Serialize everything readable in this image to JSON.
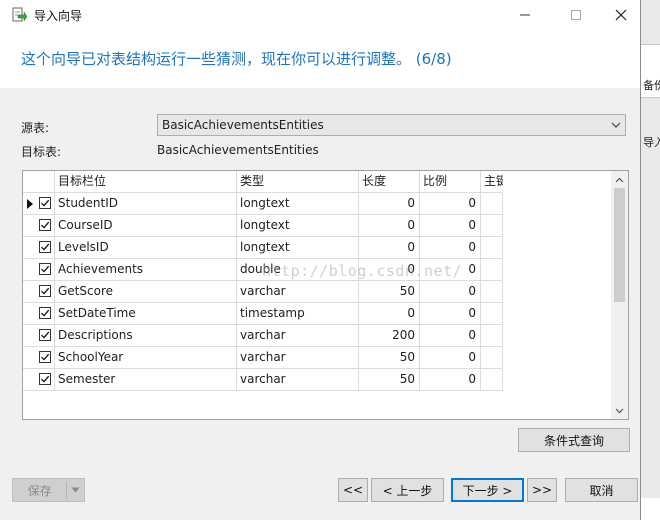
{
  "window": {
    "title": "导入向导",
    "controls": {
      "minimize": "—",
      "maximize": "☐",
      "close": "✕"
    }
  },
  "heading": "这个向导已对表结构运行一些猜测，现在你可以进行调整。 (6/8)",
  "source": {
    "label": "源表:",
    "value": "BasicAchievementsEntities"
  },
  "target": {
    "label": "目标表:",
    "value": "BasicAchievementsEntities"
  },
  "grid": {
    "columns": [
      "目标栏位",
      "类型",
      "长度",
      "比例",
      "主键"
    ],
    "rows": [
      {
        "name": "StudentID",
        "type": "longtext",
        "length": "0",
        "scale": "0",
        "checked": true,
        "current": true
      },
      {
        "name": "CourseID",
        "type": "longtext",
        "length": "0",
        "scale": "0",
        "checked": true,
        "current": false
      },
      {
        "name": "LevelsID",
        "type": "longtext",
        "length": "0",
        "scale": "0",
        "checked": true,
        "current": false
      },
      {
        "name": "Achievements",
        "type": "double",
        "length": "0",
        "scale": "0",
        "checked": true,
        "current": false
      },
      {
        "name": "GetScore",
        "type": "varchar",
        "length": "50",
        "scale": "0",
        "checked": true,
        "current": false
      },
      {
        "name": "SetDateTime",
        "type": "timestamp",
        "length": "0",
        "scale": "0",
        "checked": true,
        "current": false
      },
      {
        "name": "Descriptions",
        "type": "varchar",
        "length": "200",
        "scale": "0",
        "checked": true,
        "current": false
      },
      {
        "name": "SchoolYear",
        "type": "varchar",
        "length": "50",
        "scale": "0",
        "checked": true,
        "current": false
      },
      {
        "name": "Semester",
        "type": "varchar",
        "length": "50",
        "scale": "0",
        "checked": true,
        "current": false
      }
    ]
  },
  "watermark": "http://blog.csdn.net/",
  "buttons": {
    "condition_query": "条件式查询",
    "save": "保存",
    "first": "<<",
    "prev": "< 上一步",
    "next": "下一步 >",
    "last": ">>",
    "cancel": "取消"
  },
  "background_window": {
    "text_top": "备份",
    "text_mid": "导入"
  },
  "colors": {
    "heading": "#1e74c3",
    "focus_border": "#0078d7"
  },
  "icons": {
    "app": "import-wizard-icon",
    "dropdown": "chevron-down-icon"
  }
}
